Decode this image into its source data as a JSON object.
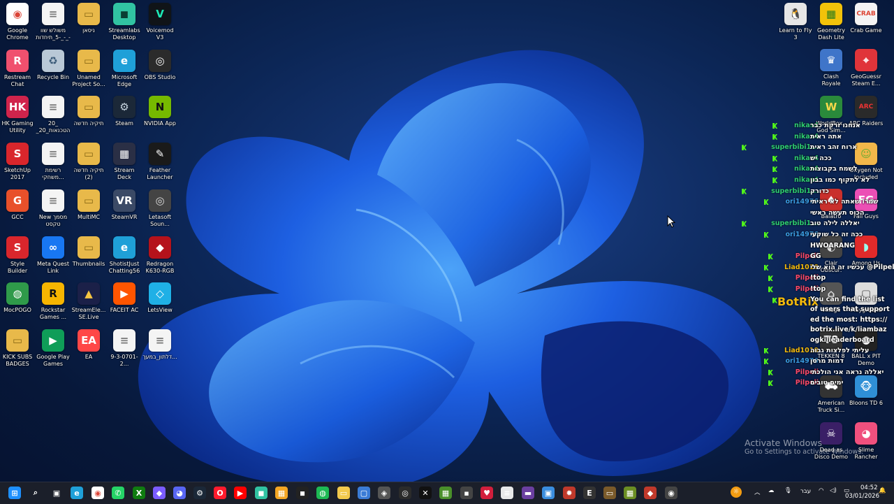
{
  "desktop_icons": [
    {
      "label": "Google Chrome",
      "color": "#ffffff",
      "glyph": "◉",
      "fg": "#db4437"
    },
    {
      "label": "משולש שוו -5_תיחדות_-_-_...",
      "color": "#f4f4f4",
      "glyph": "≡",
      "fg": "#777"
    },
    {
      "label": "ניסאן",
      "color": "#e8b94a",
      "glyph": "▭",
      "fg": "#8a6a16"
    },
    {
      "label": "Streamlabs Desktop",
      "color": "#31c3a2",
      "glyph": "◼",
      "fg": "#0a3d33"
    },
    {
      "label": "Voicemod V3",
      "color": "#101418",
      "glyph": "V",
      "fg": "#1de9b6"
    },
    {
      "label": "Restream Chat",
      "color": "#f0506e",
      "glyph": "R",
      "fg": "#fff"
    },
    {
      "label": "Recycle Bin",
      "color": "#b9c8d6",
      "glyph": "♻",
      "fg": "#3a5a78"
    },
    {
      "label": "Unamed Project So...",
      "color": "#e8b94a",
      "glyph": "▭",
      "fg": "#8a6a16"
    },
    {
      "label": "Microsoft Edge",
      "color": "#1fa0d8",
      "glyph": "e",
      "fg": "#fff"
    },
    {
      "label": "OBS Studio",
      "color": "#2b2b2b",
      "glyph": "◎",
      "fg": "#fff"
    },
    {
      "label": "HK Gaming Utility",
      "color": "#d0244c",
      "glyph": "HK",
      "fg": "#fff"
    },
    {
      "label": "20_ הטכנאות_20_-_ברמה20...",
      "color": "#f4f4f4",
      "glyph": "≡",
      "fg": "#777"
    },
    {
      "label": "תיקיה חדשה",
      "color": "#e8b94a",
      "glyph": "▭",
      "fg": "#8a6a16"
    },
    {
      "label": "Steam",
      "color": "#1b2838",
      "glyph": "⚙",
      "fg": "#c7d5e0"
    },
    {
      "label": "NVIDIA App",
      "color": "#76b900",
      "glyph": "N",
      "fg": "#111"
    },
    {
      "label": "SketchUp 2017",
      "color": "#d9262c",
      "glyph": "S",
      "fg": "#fff"
    },
    {
      "label": "רשימת משחקי...",
      "color": "#f4f4f4",
      "glyph": "≡",
      "fg": "#777"
    },
    {
      "label": "תיקיה חדשה (2)",
      "color": "#e8b94a",
      "glyph": "▭",
      "fg": "#8a6a16"
    },
    {
      "label": "Stream Deck",
      "color": "#2a2f45",
      "glyph": "▦",
      "fg": "#fff"
    },
    {
      "label": "Feather Launcher",
      "color": "#1a1a1a",
      "glyph": "✎",
      "fg": "#fff"
    },
    {
      "label": "GCC",
      "color": "#e8502a",
      "glyph": "G",
      "fg": "#fff"
    },
    {
      "label": "New מסמך טקסט",
      "color": "#f4f4f4",
      "glyph": "≡",
      "fg": "#777"
    },
    {
      "label": "MultiMC",
      "color": "#e8b94a",
      "glyph": "▭",
      "fg": "#8a6a16"
    },
    {
      "label": "SteamVR",
      "color": "#3b4a66",
      "glyph": "VR",
      "fg": "#fff"
    },
    {
      "label": "Letasoft Soun...",
      "color": "#444",
      "glyph": "◎",
      "fg": "#ddd"
    },
    {
      "label": "Style Builder 2017",
      "color": "#d9262c",
      "glyph": "S",
      "fg": "#fff"
    },
    {
      "label": "Meta Quest Link",
      "color": "#1877f2",
      "glyph": "∞",
      "fg": "#fff"
    },
    {
      "label": "Thumbnails",
      "color": "#e8b94a",
      "glyph": "▭",
      "fg": "#8a6a16"
    },
    {
      "label": "ShotistJust Chatting56",
      "color": "#1fa0d8",
      "glyph": "e",
      "fg": "#fff"
    },
    {
      "label": "Redragon K630-RGB",
      "color": "#b5121b",
      "glyph": "◆",
      "fg": "#fff"
    },
    {
      "label": "MocPOGO",
      "color": "#2f9a4a",
      "glyph": "◍",
      "fg": "#fff"
    },
    {
      "label": "Rockstar Games ...",
      "color": "#f7b500",
      "glyph": "R",
      "fg": "#111"
    },
    {
      "label": "StreamEle... SE.Live",
      "color": "#1b2048",
      "glyph": "▲",
      "fg": "#f5c542"
    },
    {
      "label": "FACEIT AC",
      "color": "#ff5500",
      "glyph": "▶",
      "fg": "#fff"
    },
    {
      "label": "LetsView",
      "color": "#1fb0e6",
      "glyph": "◇",
      "fg": "#fff"
    },
    {
      "label": "KICK SUBS BADGES",
      "color": "#e8b94a",
      "glyph": "▭",
      "fg": "#8a6a16"
    },
    {
      "label": "Google Play Games",
      "color": "#0f9d58",
      "glyph": "▶",
      "fg": "#fff"
    },
    {
      "label": "EA",
      "color": "#ff4747",
      "glyph": "EA",
      "fg": "#fff"
    },
    {
      "label": "9-3-0701-2...",
      "color": "#f4f4f4",
      "glyph": "≡",
      "fg": "#777"
    },
    {
      "label": "דלתון_במעך...",
      "color": "#f4f4f4",
      "glyph": "≡",
      "fg": "#777"
    }
  ],
  "right_icons": [
    {
      "label": "Learn to Fly 3",
      "color": "#e6e6e6",
      "glyph": "🐧",
      "fg": "#333"
    },
    {
      "label": "Geometry Dash Lite",
      "color": "#f2c20a",
      "glyph": "▦",
      "fg": "#2a7c1e"
    },
    {
      "label": "Crab Game",
      "color": "#f4f4f4",
      "glyph": "CRAB",
      "fg": "#d43"
    },
    {
      "label": "Clash Royale",
      "color": "#3f75c9",
      "glyph": "♛",
      "fg": "#fff"
    },
    {
      "label": "GeoGuessr Steam E...",
      "color": "#e0343a",
      "glyph": "⌖",
      "fg": "#fff"
    },
    {
      "label": "WorldBox - God Sim...",
      "color": "#2a8a3b",
      "glyph": "W",
      "fg": "#f7d84a"
    },
    {
      "label": "ARC Raiders",
      "color": "#2a2a2a",
      "glyph": "ARC",
      "fg": "#e33"
    },
    {
      "label": "Oxygen Not Included",
      "color": "#f2b74a",
      "glyph": "☺",
      "fg": "#6a3"
    },
    {
      "label": "Balatro",
      "color": "#c9302c",
      "glyph": "♠",
      "fg": "#fff"
    },
    {
      "label": "Fall Guys",
      "color": "#ec4fb5",
      "glyph": "FG",
      "fg": "#fff"
    },
    {
      "label": "Clair Obscur: Expedition 33",
      "color": "#444",
      "glyph": "◐",
      "fg": "#ddd"
    },
    {
      "label": "Among Us",
      "color": "#e12a2a",
      "glyph": "◗",
      "fg": "#9fe"
    },
    {
      "label": "Village",
      "color": "#555",
      "glyph": "⌂",
      "fg": "#ddd"
    },
    {
      "label": "Playground",
      "color": "#ddd",
      "glyph": "▢",
      "fg": "#555"
    },
    {
      "label": "TEKKEN 8",
      "color": "#333",
      "glyph": "T8",
      "fg": "#fff"
    },
    {
      "label": "BALL x PIT Demo",
      "color": "#222",
      "glyph": "●",
      "fg": "#fff"
    },
    {
      "label": "American Truck Si...",
      "color": "#333",
      "glyph": "⛟",
      "fg": "#fff"
    },
    {
      "label": "Bloons TD 6",
      "color": "#2f8fd6",
      "glyph": "🐵",
      "fg": "#fff"
    },
    {
      "label": "Dead as Disco Demo",
      "color": "#3a1f66",
      "glyph": "☠",
      "fg": "#fff"
    },
    {
      "label": "Slime Rancher",
      "color": "#f0507e",
      "glyph": "◕",
      "fg": "#fff"
    }
  ],
  "chat": [
    {
      "user": "nikas4",
      "color": "#2ecc71",
      "msg": "אנחנו זרקת כבר"
    },
    {
      "user": "nikas4",
      "color": "#2ecc71",
      "msg": "אתה ראית"
    },
    {
      "user": "superbibi1...",
      "color": "#2ecc71",
      "msg": "ארוח זהב ראית"
    },
    {
      "user": "nikas4",
      "color": "#2ecc71",
      "msg": "ככה יש"
    },
    {
      "user": "nikas4",
      "color": "#2ecc71",
      "msg": "לשמח בקבוצות"
    },
    {
      "user": "nikas4",
      "color": "#2ecc71",
      "msg": "לא לתקוף כמו בבון"
    },
    {
      "user": "superbibi1...",
      "color": "#2ecc71",
      "msg": "כדורק"
    },
    {
      "user": "ori14976",
      "color": "#3a9be0",
      "msg": "שמרו שאתה לא ראיתי"
    },
    {
      "user": "",
      "color": "#2ecc71",
      "msg": "הכוס תעשה ראשי"
    },
    {
      "user": "superbibi1...",
      "color": "#2ecc71",
      "msg": "יאללה לילה טוב"
    },
    {
      "user": "ori14976",
      "color": "#3a9be0",
      "msg": "ככה זה כל שוקעי"
    },
    {
      "user": "",
      "color": "#2ecc71",
      "msg": "HWOARANG"
    },
    {
      "user": "Pilpeli",
      "color": "#ff4a6a",
      "msg": "GG"
    },
    {
      "user": "Liad1010",
      "color": "#f2b90d",
      "msg": "עכשיו זה הוא שלי @Pilpeli"
    },
    {
      "user": "Pilpeli",
      "color": "#ff4a6a",
      "msg": "!top"
    },
    {
      "user": "Pilpeli",
      "color": "#ff4a6a",
      "msg": "!top"
    }
  ],
  "chat_bot": {
    "user": "BotRix",
    "color": "#f2b90d",
    "msg": "You can find the list of users that supported the most: https://botrix.live/k/liambazogki/leaderboard"
  },
  "chat_tail": [
    {
      "user": "Liad1010",
      "color": "#f2b90d",
      "msg": "עליתי לפלצות גבוה"
    },
    {
      "user": "ori14976",
      "color": "#3a9be0",
      "msg": "דמות מרסן"
    },
    {
      "user": "Pilpeli",
      "color": "#ff4a6a",
      "msg": "יאללה נראה אני הולכתי"
    },
    {
      "user": "Pilpeli",
      "color": "#ff4a6a",
      "msg": "ימים טובים"
    }
  ],
  "watermark": {
    "title": "Activate Windows",
    "subtitle": "Go to Settings to activate Windows."
  },
  "taskbar": {
    "icons": [
      {
        "name": "start-icon",
        "color": "#1e90ff",
        "glyph": "⊞"
      },
      {
        "name": "search-icon",
        "color": "transparent",
        "glyph": "⌕"
      },
      {
        "name": "task-view-icon",
        "color": "transparent",
        "glyph": "▣"
      },
      {
        "name": "edge-icon",
        "color": "#1fa0d8",
        "glyph": "e"
      },
      {
        "name": "chrome-icon",
        "color": "#ffffff",
        "glyph": "◉"
      },
      {
        "name": "whatsapp-icon",
        "color": "#25d366",
        "glyph": "✆"
      },
      {
        "name": "xbox-icon",
        "color": "#107c10",
        "glyph": "X"
      },
      {
        "name": "copilot-icon",
        "color": "#7b5cff",
        "glyph": "◆"
      },
      {
        "name": "discord-icon",
        "color": "#5865f2",
        "glyph": "◕"
      },
      {
        "name": "steam-icon",
        "color": "#1b2838",
        "glyph": "⚙"
      },
      {
        "name": "opera-icon",
        "color": "#ff1b2d",
        "glyph": "O"
      },
      {
        "name": "youtube-icon",
        "color": "#ff0000",
        "glyph": "▶"
      },
      {
        "name": "streamlabs-icon",
        "color": "#31c3a2",
        "glyph": "◼"
      },
      {
        "name": "store-icon",
        "color": "#f5a623",
        "glyph": "▦"
      },
      {
        "name": "black-app-icon",
        "color": "#222",
        "glyph": "◾"
      },
      {
        "name": "spotify-icon",
        "color": "#1db954",
        "glyph": "◍"
      },
      {
        "name": "file-explorer-icon",
        "color": "#f2c94c",
        "glyph": "▭"
      },
      {
        "name": "settings-app-icon",
        "color": "#3a7bd5",
        "glyph": "▢"
      },
      {
        "name": "shield-icon",
        "color": "#555",
        "glyph": "◈"
      },
      {
        "name": "obs-icon",
        "color": "#2b2b2b",
        "glyph": "◎"
      },
      {
        "name": "capcut-icon",
        "color": "#111",
        "glyph": "✕"
      },
      {
        "name": "minecraft-icon",
        "color": "#4a8f2a",
        "glyph": "▦"
      },
      {
        "name": "app-gray-icon",
        "color": "#444",
        "glyph": "▪"
      },
      {
        "name": "heart-icon",
        "color": "#d21f3c",
        "glyph": "♥"
      },
      {
        "name": "notepad-icon",
        "color": "#e8e8e8",
        "glyph": "≡"
      },
      {
        "name": "purple-app-icon",
        "color": "#6b3fa0",
        "glyph": "▬"
      },
      {
        "name": "blue-app-icon",
        "color": "#3a8dde",
        "glyph": "▣"
      },
      {
        "name": "red-gear-icon",
        "color": "#c0392b",
        "glyph": "✹"
      },
      {
        "name": "epic-icon",
        "color": "#333",
        "glyph": "E"
      },
      {
        "name": "brown-app-icon",
        "color": "#7a5a2a",
        "glyph": "▭"
      },
      {
        "name": "minecraft-launcher-icon",
        "color": "#6b8e23",
        "glyph": "▦"
      },
      {
        "name": "red-app-icon",
        "color": "#c0392b",
        "glyph": "◆"
      },
      {
        "name": "chrome-profile-icon",
        "color": "#444",
        "glyph": "◉"
      }
    ],
    "tray": {
      "weather_glyph": "☼",
      "lang": "עבר",
      "time": "04:52",
      "date": "03/01/2026"
    }
  }
}
